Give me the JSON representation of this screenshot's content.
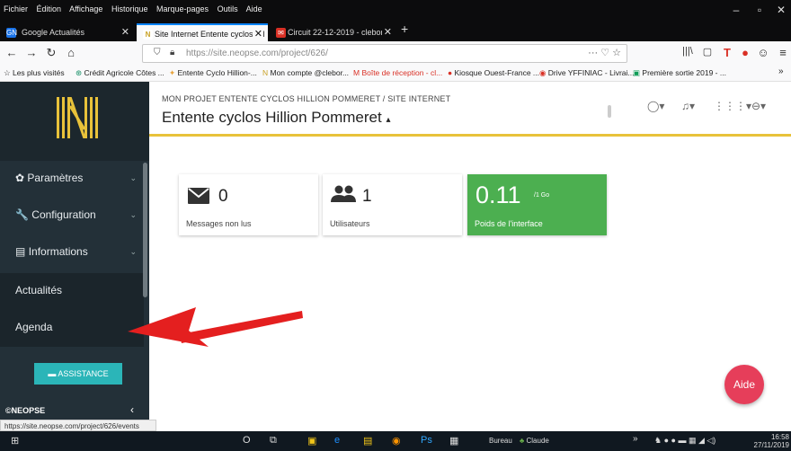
{
  "browser": {
    "menu": [
      "Fichier",
      "Édition",
      "Affichage",
      "Historique",
      "Marque-pages",
      "Outils",
      "Aide"
    ],
    "window_controls": [
      "–",
      "▫",
      "✕"
    ],
    "tabs": [
      {
        "label": "Google Actualités",
        "icon": "GN",
        "icon_color": "#1a73e8",
        "close": "✕"
      },
      {
        "label": "Site Internet Entente cyclos Hil",
        "icon": "N",
        "icon_color": "#c9a227",
        "close": "✕"
      },
      {
        "label": "Circuit 22-12-2019 - cleborgn",
        "icon": "✉",
        "icon_color": "#d93025",
        "close": "✕"
      }
    ],
    "newtab": "+",
    "url": {
      "host": "https://site.neopse.com",
      "path": "/project/626/"
    },
    "url_actions": "···  ♡  ☆",
    "toolbar_right": [
      "|||\\",
      "▢",
      "T",
      "●",
      "☺",
      "≡"
    ],
    "bookmarks": [
      "☆ Les plus visités",
      "Crédit Agricole Côtes ...",
      "Entente Cyclo Hillion-...",
      "Mon compte @clebor...",
      "M  Boîte de réception - cl...",
      "Kiosque Ouest-France ...",
      "Drive YFFINIAC - Livrai...",
      "Première sortie 2019 - ..."
    ],
    "bookmarks_more": "»",
    "status_url": "https://site.neopse.com/project/626/events"
  },
  "sidebar": {
    "items": [
      {
        "label": "Paramètres",
        "icon": "✿",
        "chevron": "⌄"
      },
      {
        "label": "Configuration",
        "icon": "🔧",
        "chevron": "⌄"
      },
      {
        "label": "Informations",
        "icon": "▤",
        "chevron": "⌄"
      },
      {
        "label": "Actualités"
      },
      {
        "label": "Agenda"
      }
    ],
    "assistance_label": "ASSISTANCE",
    "footer_brand": "©NEOPSE",
    "collapse": "‹"
  },
  "header": {
    "breadcrumb": "MON PROJET ENTENTE CYCLOS HILLION POMMERET / SITE INTERNET",
    "title": "Entente cyclos Hillion Pommeret",
    "title_caret": "▴",
    "icons": [
      "chat-icon",
      "bell-icon",
      "apps-grid-icon",
      "user-icon"
    ]
  },
  "stats": [
    {
      "value": "0",
      "caption": "Messages non lus",
      "icon": "envelope-icon"
    },
    {
      "value": "1",
      "caption": "Utilisateurs",
      "icon": "users-icon"
    },
    {
      "value": "0.11",
      "unit": "/1 Go",
      "caption": "Poids de l'interface",
      "color": "#4caf50"
    }
  ],
  "help_button": "Aide",
  "annotation": {
    "arrow_color": "#e41f1f"
  },
  "taskbar": {
    "search_icon": "O",
    "bureau": "Bureau",
    "user": "Claude",
    "time": "16:58",
    "date": "27/11/2019",
    "arrow": "»"
  }
}
